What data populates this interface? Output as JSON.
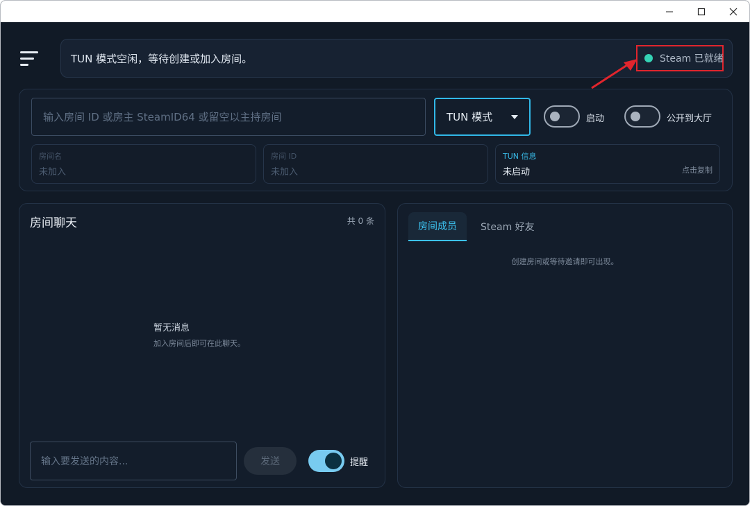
{
  "status": {
    "message": "TUN 模式空闲，等待创建或加入房间。",
    "steam_status": "Steam 已就绪",
    "steam_dot_color": "#35d3b5"
  },
  "room": {
    "id_placeholder": "输入房间 ID 或房主 SteamID64 或留空以主持房间",
    "mode_value": "TUN 模式",
    "start_label": "启动",
    "start_enabled": false,
    "public_label": "公开到大厅",
    "public_enabled": false
  },
  "info_cards": {
    "room_name": {
      "label": "房间名",
      "value": "未加入"
    },
    "room_id": {
      "label": "房间 ID",
      "value": "未加入"
    },
    "tun": {
      "label": "TUN 信息",
      "value": "未启动",
      "action": "点击复制"
    }
  },
  "chat": {
    "title": "房间聊天",
    "count": "共 0 条",
    "empty_title": "暂无消息",
    "empty_subtitle": "加入房间后即可在此聊天。",
    "input_placeholder": "输入要发送的内容...",
    "send_label": "发送",
    "remind_label": "提醒",
    "remind_enabled": true
  },
  "members": {
    "tabs": [
      {
        "label": "房间成员",
        "active": true
      },
      {
        "label": "Steam 好友",
        "active": false
      }
    ],
    "empty_hint": "创建房间或等待邀请即可出现。"
  },
  "colors": {
    "accent": "#31b8e8",
    "highlight_box": "#e1252d",
    "background": "#111a26"
  }
}
